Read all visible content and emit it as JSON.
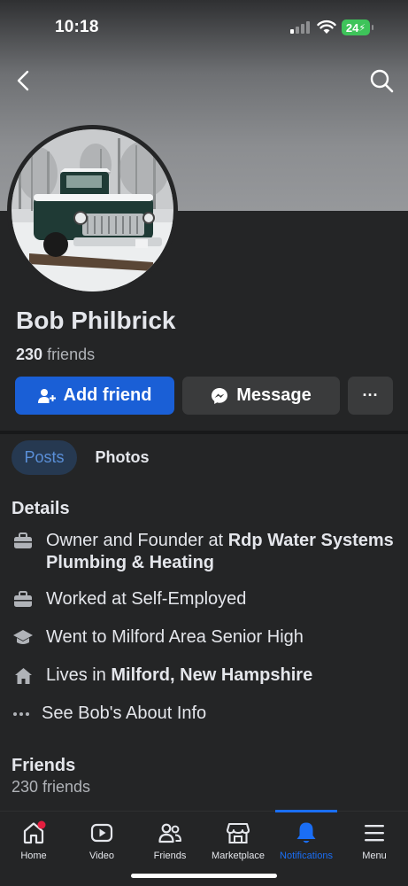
{
  "status_bar": {
    "time": "10:18",
    "battery": "24"
  },
  "profile": {
    "name": "Bob Philbrick",
    "friends_number": "230",
    "friends_word": "friends"
  },
  "actions": {
    "add_friend": "Add friend",
    "message": "Message",
    "more": "···"
  },
  "tabs": [
    {
      "label": "Posts",
      "active": true
    },
    {
      "label": "Photos",
      "active": false
    }
  ],
  "details": {
    "title": "Details",
    "work1_prefix": "Owner and Founder at ",
    "work1_bold": "Rdp Water Systems",
    "work1_line2": "Plumbing & Heating",
    "work2": "Worked at Self-Employed",
    "education": "Went to Milford Area Senior High",
    "lives_prefix": "Lives in ",
    "lives_bold": "Milford, New Hampshire",
    "about": "See Bob's About Info"
  },
  "friends_section": {
    "title": "Friends",
    "count": "230 friends"
  },
  "nav": [
    {
      "label": "Home",
      "icon": "home-icon",
      "badge": true
    },
    {
      "label": "Video",
      "icon": "video-icon"
    },
    {
      "label": "Friends",
      "icon": "friends-icon"
    },
    {
      "label": "Marketplace",
      "icon": "marketplace-icon"
    },
    {
      "label": "Notifications",
      "icon": "bell-icon",
      "active": true
    },
    {
      "label": "Menu",
      "icon": "menu-icon"
    }
  ],
  "colors": {
    "accent": "#1a5fd6",
    "active_tab": "#1a6ef5",
    "background": "#242526",
    "battery": "#3ec45a"
  }
}
